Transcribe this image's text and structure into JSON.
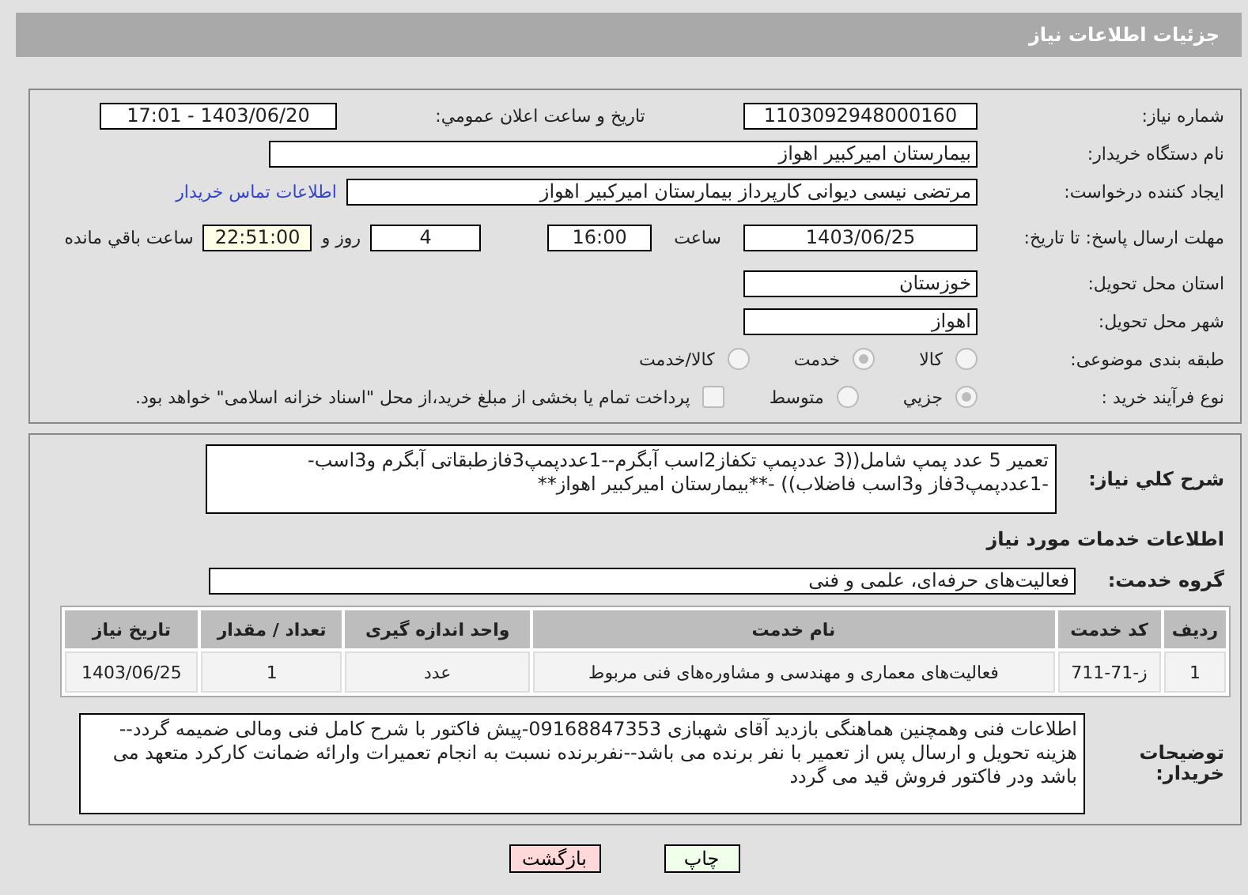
{
  "header": {
    "title": "جزئیات اطلاعات نیاز"
  },
  "need_number": {
    "label": "شماره نیاز:",
    "value": "1103092948000160"
  },
  "announce": {
    "label": "تاريخ و ساعت اعلان عمومي:",
    "value": "1403/06/20 - 17:01"
  },
  "buyer": {
    "label": "نام دستگاه خریدار:",
    "value": "بيمارستان اميرکبير اهواز"
  },
  "creator": {
    "label": "ایجاد کننده درخواست:",
    "value": "مرتضی نیسی دیوانی کارپرداز بیمارستان امیرکبیر اهواز",
    "link": "اطلاعات تماس خریدار"
  },
  "deadline": {
    "label": "مهلت ارسال پاسخ: تا تاریخ:",
    "date": "1403/06/25",
    "time_label": "ساعت",
    "time": "16:00",
    "days": "4",
    "days_label": "روز و",
    "remaining": "22:51:00",
    "remaining_label": "ساعت باقي مانده"
  },
  "province": {
    "label": "استان محل تحویل:",
    "value": "خوزستان"
  },
  "city": {
    "label": "شهر محل تحویل:",
    "value": "اهواز"
  },
  "category": {
    "label": "طبقه بندی موضوعی:",
    "options": [
      {
        "label": "كالا",
        "selected": false
      },
      {
        "label": "خدمت",
        "selected": true
      },
      {
        "label": "كالا/خدمت",
        "selected": false
      }
    ]
  },
  "process": {
    "label": "نوع فرآیند خرید :",
    "options": [
      {
        "label": "جزيي",
        "selected": true
      },
      {
        "label": "متوسط",
        "selected": false
      }
    ],
    "treasury": {
      "checked": false,
      "text": "پرداخت تمام یا بخشی از مبلغ خرید،از محل \"اسناد خزانه اسلامی\" خواهد بود."
    }
  },
  "description": {
    "label": "شرح کلي نياز:",
    "value": "تعمیر 5 عدد پمپ شامل((3 عددپمپ تکفاز2اسب آبگرم--1عددپمپ3فازطبقاتی آبگرم و3اسب--1عددپمپ3فاز و3اسب فاضلاب)) -**بیمارستان امیرکبیر اهواز**"
  },
  "services_heading": "اطلاعات خدمات مورد نیاز",
  "service_group": {
    "label": "گروه خدمت:",
    "value": "فعالیت‌های حرفه‌ای، علمی و فنی"
  },
  "table": {
    "columns": [
      "ردیف",
      "کد خدمت",
      "نام خدمت",
      "واحد اندازه گیری",
      "تعداد / مقدار",
      "تاریخ نیاز"
    ],
    "rows": [
      [
        "1",
        "ز-71-711",
        "فعالیت‌های معماری و مهندسی و مشاوره‌های فنی مربوط",
        "عدد",
        "1",
        "1403/06/25"
      ]
    ]
  },
  "buyer_notes": {
    "label": "توضیحات خریدار:",
    "value": "اطلاعات فنی وهمچنین هماهنگی بازدید آقای شهبازی 09168847353-پیش فاکتور با شرح کامل فنی ومالی ضمیمه گردد--هزینه تحویل و ارسال پس از تعمیر با نفر برنده می باشد--نفربرنده نسبت به انجام تعمیرات وارائه ضمانت کارکرد متعهد می باشد ودر فاکتور فروش قید می گردد"
  },
  "buttons": [
    {
      "label": "چاپ",
      "kind": "print"
    },
    {
      "label": "بازگشت",
      "kind": "back"
    }
  ]
}
